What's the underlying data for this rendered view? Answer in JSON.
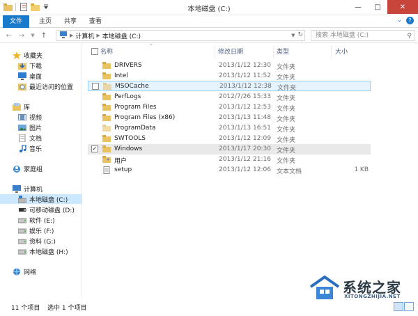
{
  "window": {
    "title": "本地磁盘 (C:)"
  },
  "ribbon": {
    "tabs": [
      "文件",
      "主页",
      "共享",
      "查看"
    ]
  },
  "address": {
    "crumbs": [
      "计算机",
      "本地磁盘 (C:)"
    ],
    "search_placeholder": "搜索 本地磁盘 (C:)"
  },
  "nav": {
    "favorites": {
      "label": "收藏夹",
      "items": [
        "下载",
        "桌面",
        "最近访问的位置"
      ]
    },
    "libraries": {
      "label": "库",
      "items": [
        "视频",
        "图片",
        "文档",
        "音乐"
      ]
    },
    "homegroup": "家庭组",
    "computer": {
      "label": "计算机",
      "items": [
        "本地磁盘 (C:)",
        "可移动磁盘 (D:)",
        "软件 (E:)",
        "娱乐 (F:)",
        "资料 (G:)",
        "本地磁盘 (H:)"
      ]
    },
    "network": "网络"
  },
  "columns": {
    "name": "名称",
    "date": "修改日期",
    "type": "类型",
    "size": "大小"
  },
  "files": [
    {
      "name": "DRIVERS",
      "date": "2013/1/12 12:30",
      "type": "文件夹",
      "size": ""
    },
    {
      "name": "Intel",
      "date": "2013/1/12 11:52",
      "type": "文件夹",
      "size": ""
    },
    {
      "name": "MSOCache",
      "date": "2013/1/12 12:38",
      "type": "文件夹",
      "size": ""
    },
    {
      "name": "PerfLogs",
      "date": "2012/7/26 15:33",
      "type": "文件夹",
      "size": ""
    },
    {
      "name": "Program Files",
      "date": "2013/1/12 12:53",
      "type": "文件夹",
      "size": ""
    },
    {
      "name": "Program Files (x86)",
      "date": "2013/1/13 11:48",
      "type": "文件夹",
      "size": ""
    },
    {
      "name": "ProgramData",
      "date": "2013/1/13 16:51",
      "type": "文件夹",
      "size": ""
    },
    {
      "name": "SWTOOLS",
      "date": "2013/1/12 12:09",
      "type": "文件夹",
      "size": ""
    },
    {
      "name": "Windows",
      "date": "2013/1/17 20:30",
      "type": "文件夹",
      "size": ""
    },
    {
      "name": "用户",
      "date": "2013/1/12 21:16",
      "type": "文件夹",
      "size": ""
    },
    {
      "name": "setup",
      "date": "2013/1/12 12:06",
      "type": "文本文档",
      "size": "1 KB"
    }
  ],
  "status": {
    "count": "11 个项目",
    "selected": "选中 1 个项目"
  },
  "watermark": {
    "name": "系统之家",
    "url": "XITONGZHIJIA.NET"
  },
  "colors": {
    "accent": "#1979ca",
    "folder": "#e8c263",
    "selection": "#cce8ff"
  }
}
